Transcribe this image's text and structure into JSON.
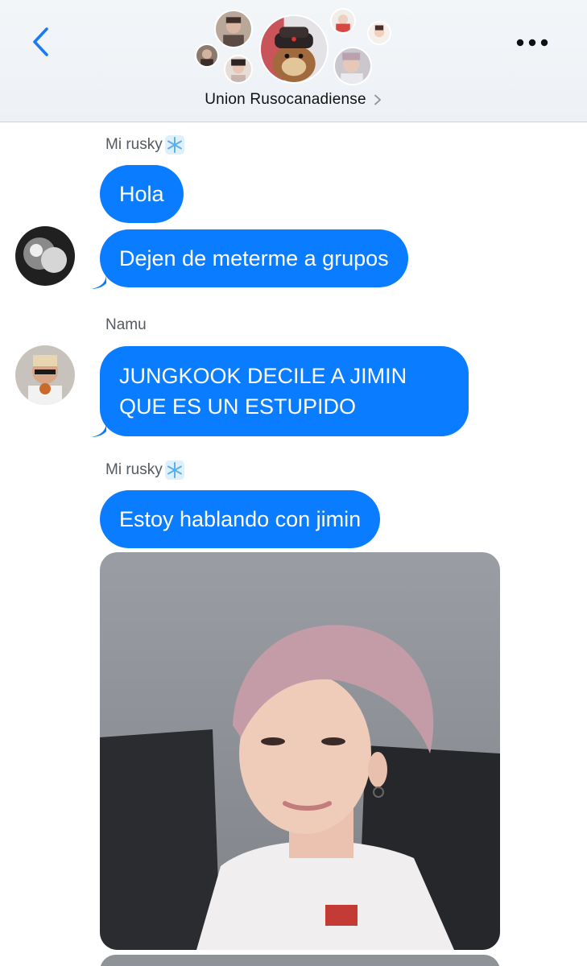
{
  "header": {
    "group_name": "Union Rusocanadiense",
    "icons": {
      "back": "chevron-left-icon",
      "more": "more-horizontal-icon",
      "title_chevron": "chevron-right-icon"
    }
  },
  "messages": [
    {
      "sender": "Mi rusky",
      "sender_emoji": "snowflake-icon",
      "bubbles": [
        "Hola",
        "Dejen de meterme a grupos"
      ]
    },
    {
      "sender": "Namu",
      "bubbles": [
        "JUNGKOOK DECILE A JIMIN",
        "QUE ES UN ESTUPIDO"
      ]
    },
    {
      "sender": "Mi rusky",
      "sender_emoji": "snowflake-icon",
      "bubbles": [
        "Estoy hablando con jimin"
      ],
      "attachment": "photo"
    }
  ],
  "colors": {
    "bubble": "#0a7cff",
    "accent": "#1a7cf5",
    "header_bg": "#eef2f6",
    "sender_text": "#555a60"
  }
}
